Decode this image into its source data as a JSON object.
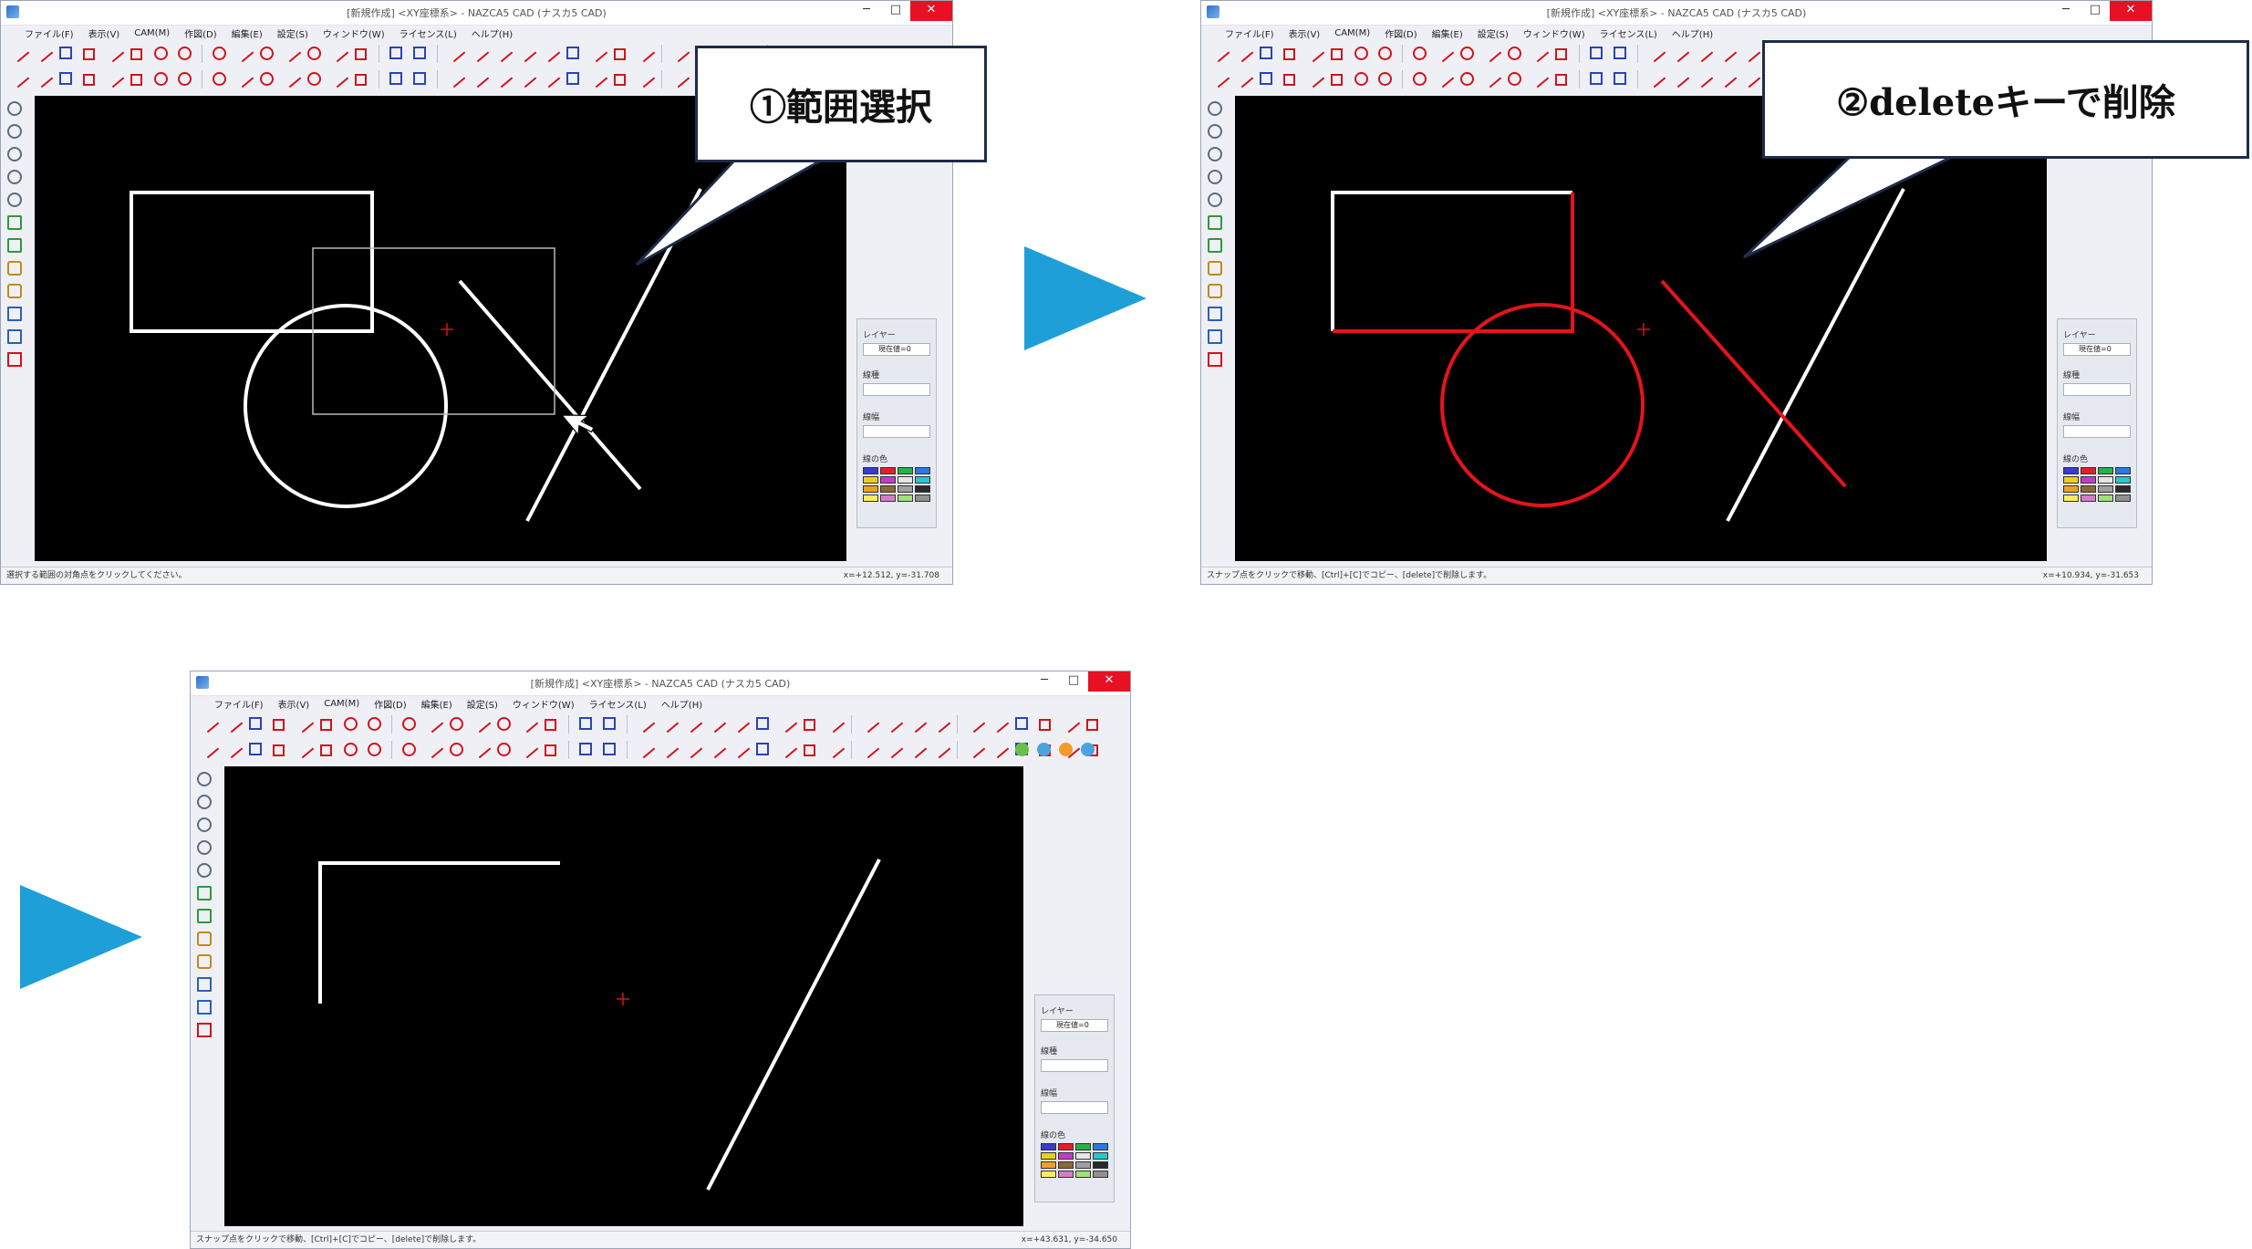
{
  "window": {
    "title_new": "[新規作成] <XY座標系> - NAZCA5 CAD (ナスカ5 CAD)",
    "menu": [
      "ファイル(F)",
      "表示(V)",
      "CAM(M)",
      "作図(D)",
      "編集(E)",
      "設定(S)",
      "ウィンドウ(W)",
      "ライセンス(L)",
      "ヘルプ(H)"
    ],
    "min_label": "─",
    "max_label": "□",
    "close_label": "✕"
  },
  "panel": {
    "layer_label": "レイヤー",
    "layer_value": "現在値=0",
    "linetype_label": "線種",
    "linewidth_label": "線幅",
    "linecolor_label": "線の色"
  },
  "steps": {
    "one": {
      "callout": "①範囲選択",
      "status_left": "選択する範囲の対角点をクリックしてください。",
      "status_right": "x=+12.512, y=-31.708"
    },
    "two": {
      "callout": "②deleteキーで削除",
      "status_left": "スナップ点をクリックで移動、[Ctrl]+[C]でコピー、[delete]で削除します。",
      "status_right": "x=+10.934, y=-31.653"
    },
    "three": {
      "status_left": "スナップ点をクリックで移動、[Ctrl]+[C]でコピー、[delete]で削除します。",
      "status_right": "x=+43.631, y=-34.650"
    }
  },
  "colors": {
    "arrow": "#1f9fd8",
    "selected": "#e4141b",
    "geometry": "#ffffff",
    "canvas": "#000000"
  },
  "swatch_colors": [
    "#3a3acc",
    "#e61e2b",
    "#27b04a",
    "#2a7adf",
    "#e6d21e",
    "#c53cc7",
    "#e6e6e6",
    "#28c8d0",
    "#f0a020",
    "#8a6a3a",
    "#a0a0a0",
    "#2a2a2a",
    "#ffeb60",
    "#d67cc8",
    "#9fe07a",
    "#909090"
  ]
}
